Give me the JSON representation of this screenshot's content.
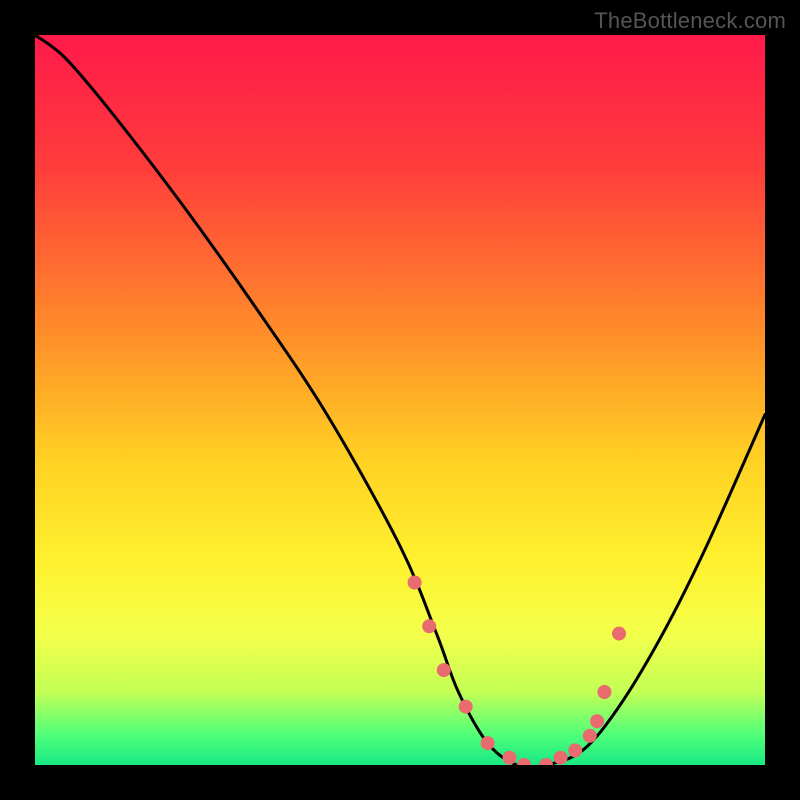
{
  "watermark": "TheBottleneck.com",
  "chart_data": {
    "type": "line",
    "title": "",
    "xlabel": "",
    "ylabel": "",
    "xlim": [
      0,
      100
    ],
    "ylim": [
      0,
      100
    ],
    "series": [
      {
        "name": "bottleneck-curve",
        "x": [
          0,
          4,
          10,
          20,
          30,
          40,
          50,
          55,
          58,
          62,
          66,
          70,
          75,
          80,
          86,
          92,
          100
        ],
        "values": [
          100,
          97,
          90,
          77,
          63,
          48,
          30,
          18,
          10,
          3,
          0,
          0,
          2,
          8,
          18,
          30,
          48
        ]
      }
    ],
    "markers": {
      "name": "highlight-dots",
      "color": "#e96a6f",
      "x": [
        52,
        54,
        56,
        59,
        62,
        65,
        67,
        70,
        72,
        74,
        76,
        77,
        78,
        80
      ],
      "values": [
        25,
        19,
        13,
        8,
        3,
        1,
        0,
        0,
        1,
        2,
        4,
        6,
        10,
        18
      ]
    },
    "background_gradient": {
      "stops": [
        {
          "offset": 0,
          "color": "#ff1a4a"
        },
        {
          "offset": 18,
          "color": "#ff3c3c"
        },
        {
          "offset": 40,
          "color": "#ff8a2a"
        },
        {
          "offset": 58,
          "color": "#ffd023"
        },
        {
          "offset": 72,
          "color": "#fff12e"
        },
        {
          "offset": 82,
          "color": "#f4ff4a"
        },
        {
          "offset": 90,
          "color": "#c3ff55"
        },
        {
          "offset": 96,
          "color": "#4eff7a"
        },
        {
          "offset": 100,
          "color": "#18e884"
        }
      ]
    }
  }
}
